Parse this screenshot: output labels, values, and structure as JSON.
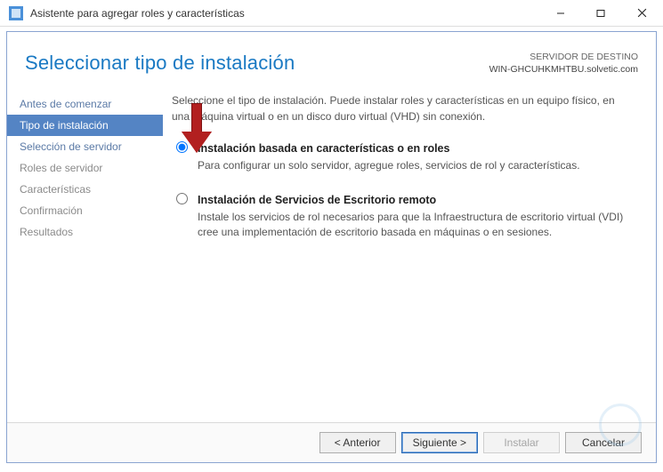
{
  "window": {
    "title": "Asistente para agregar roles y características"
  },
  "header": {
    "page_title": "Seleccionar tipo de instalación",
    "dest_label": "SERVIDOR DE DESTINO",
    "dest_server": "WIN-GHCUHKMHTBU.solvetic.com"
  },
  "sidebar": {
    "steps": [
      {
        "label": "Antes de comenzar",
        "state": "clickable"
      },
      {
        "label": "Tipo de instalación",
        "state": "active"
      },
      {
        "label": "Selección de servidor",
        "state": "clickable"
      },
      {
        "label": "Roles de servidor",
        "state": "disabled"
      },
      {
        "label": "Características",
        "state": "disabled"
      },
      {
        "label": "Confirmación",
        "state": "disabled"
      },
      {
        "label": "Resultados",
        "state": "disabled"
      }
    ]
  },
  "main": {
    "intro": "Seleccione el tipo de instalación. Puede instalar roles y características en un equipo físico, en una máquina virtual o en un disco duro virtual (VHD) sin conexión.",
    "options": [
      {
        "title": "Instalación basada en características o en roles",
        "desc": "Para configurar un solo servidor, agregue roles, servicios de rol y características.",
        "selected": true
      },
      {
        "title": "Instalación de Servicios de Escritorio remoto",
        "desc": "Instale los servicios de rol necesarios para que la Infraestructura de escritorio virtual (VDI) cree una implementación de escritorio basada en máquinas o en sesiones.",
        "selected": false
      }
    ]
  },
  "buttons": {
    "prev": "< Anterior",
    "next": "Siguiente >",
    "install": "Instalar",
    "cancel": "Cancelar"
  }
}
